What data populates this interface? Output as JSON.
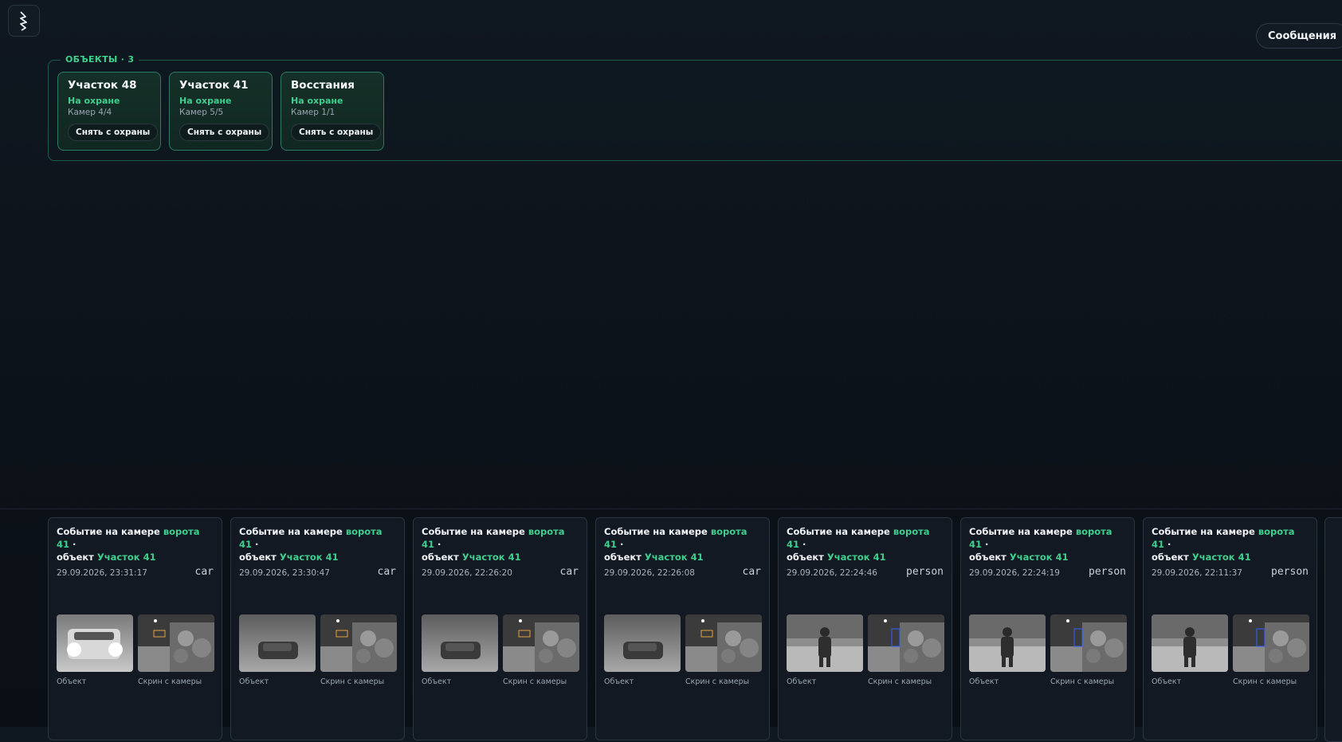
{
  "header": {
    "messages_label": "Сообщения"
  },
  "objects": {
    "legend": "ОБЪЕКТЫ · 3",
    "items": [
      {
        "title": "Участок 48",
        "status": "На охране",
        "cams": "Камер 4/4",
        "action": "Снять с охраны"
      },
      {
        "title": "Участок 41",
        "status": "На охране",
        "cams": "Камер 5/5",
        "action": "Снять с охраны"
      },
      {
        "title": "Восстания",
        "status": "На охране",
        "cams": "Камер 1/1",
        "action": "Снять с охраны"
      }
    ]
  },
  "events": {
    "prefix": "Событие на камере",
    "sep": " · ",
    "object_word": "объект",
    "label_object": "Объект",
    "label_screen": "Скрин с камеры",
    "items": [
      {
        "camera": "ворота 41",
        "object": "Участок 41",
        "time": "29.09.2026, 23:31:17",
        "class": "car"
      },
      {
        "camera": "ворота 41",
        "object": "Участок 41",
        "time": "29.09.2026, 23:30:47",
        "class": "car"
      },
      {
        "camera": "ворота 41",
        "object": "Участок 41",
        "time": "29.09.2026, 22:26:20",
        "class": "car"
      },
      {
        "camera": "ворота 41",
        "object": "Участок 41",
        "time": "29.09.2026, 22:26:08",
        "class": "car"
      },
      {
        "camera": "ворота 41",
        "object": "Участок 41",
        "time": "29.09.2026, 22:24:46",
        "class": "person"
      },
      {
        "camera": "ворота 41",
        "object": "Участок 41",
        "time": "29.09.2026, 22:24:19",
        "class": "person"
      },
      {
        "camera": "ворота 41",
        "object": "Участок 41",
        "time": "29.09.2026, 22:11:37",
        "class": "person"
      }
    ]
  }
}
